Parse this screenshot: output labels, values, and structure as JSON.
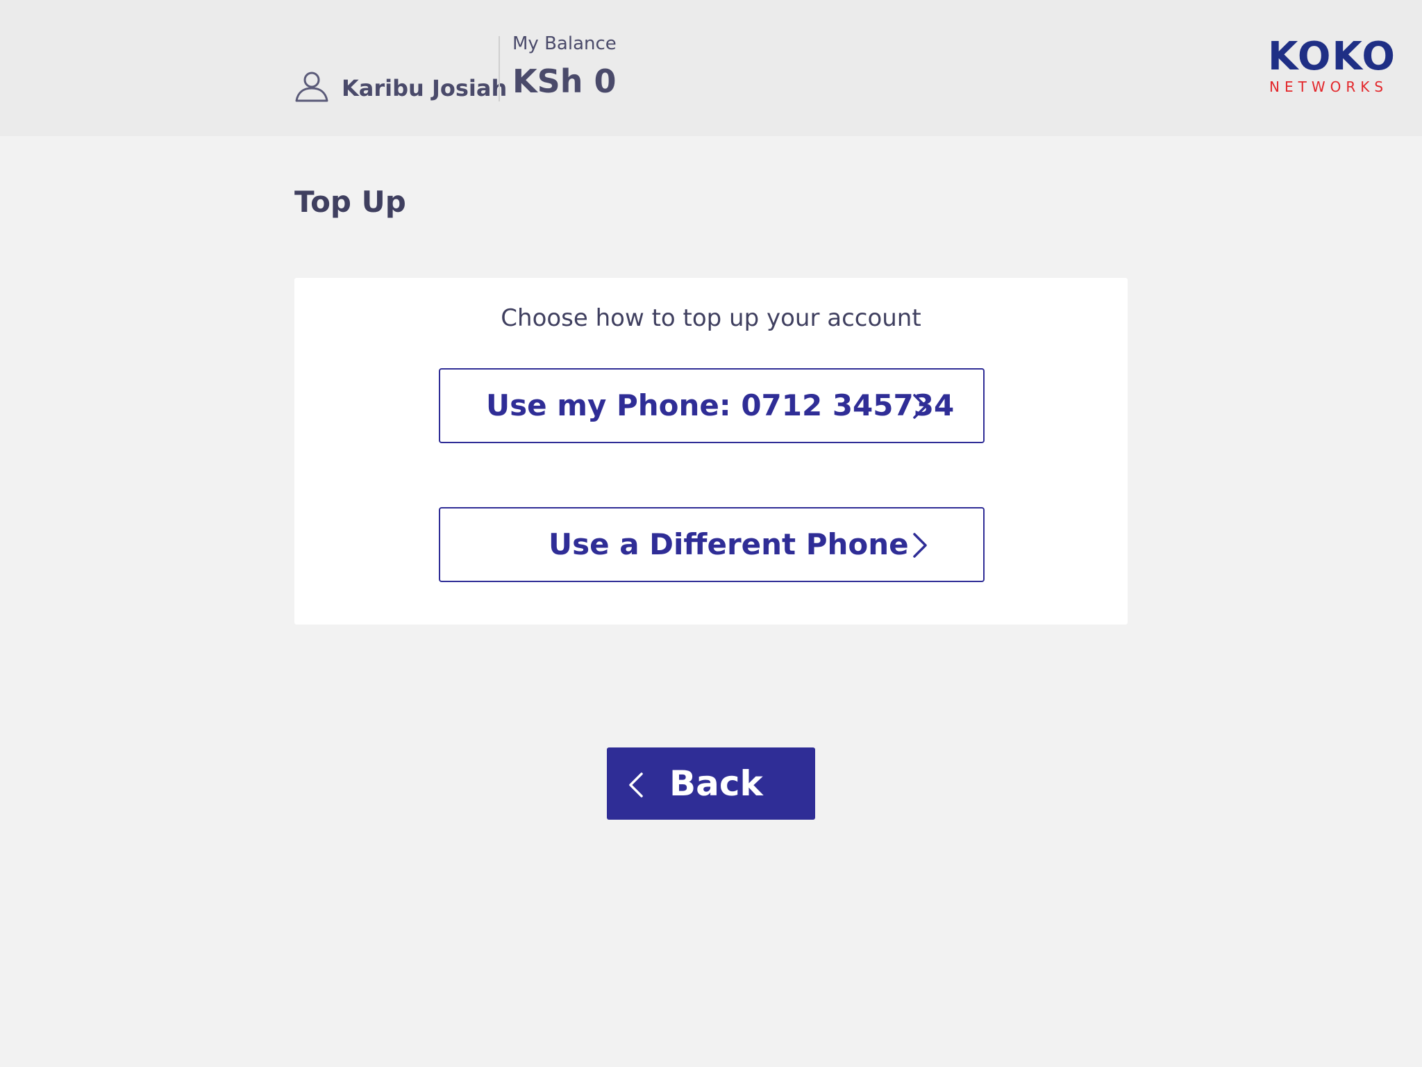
{
  "header": {
    "user_icon": "user-icon",
    "greeting": "Karibu Josiah",
    "balance_label": "My Balance",
    "balance_value": "KSh 0",
    "logo": {
      "main": "KOKO",
      "sub": "NETWORKS",
      "colors": {
        "main": "#1f2f85",
        "sub": "#e3262a"
      }
    }
  },
  "page": {
    "title": "Top Up"
  },
  "card": {
    "instruction": "Choose how to top up your account",
    "options": [
      {
        "label": "Use my Phone: 0712 345734",
        "icon": "chevron-right-icon"
      },
      {
        "label": "Use a Different Phone",
        "icon": "chevron-right-icon"
      }
    ]
  },
  "back_button": {
    "label": "Back",
    "icon": "chevron-left-icon"
  },
  "colors": {
    "accent": "#2f2d96",
    "header_bg": "#ebebeb",
    "page_bg": "#f2f2f2",
    "text": "#4a4a6a"
  }
}
